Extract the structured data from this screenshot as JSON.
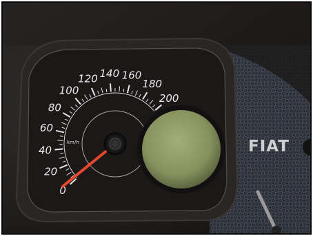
{
  "speedometer": {
    "scale_labels": [
      "0",
      "20",
      "40",
      "60",
      "80",
      "100",
      "120",
      "140",
      "160",
      "180",
      "200"
    ],
    "unit": "km/h",
    "range": [
      0,
      200
    ],
    "needle_value": 0
  },
  "brand": {
    "text": "FIAT"
  },
  "colors": {
    "needle": "#e8472f",
    "dial_face": "#1b1817",
    "display": "#8f9a66",
    "carbon": "#3a3f4c"
  }
}
